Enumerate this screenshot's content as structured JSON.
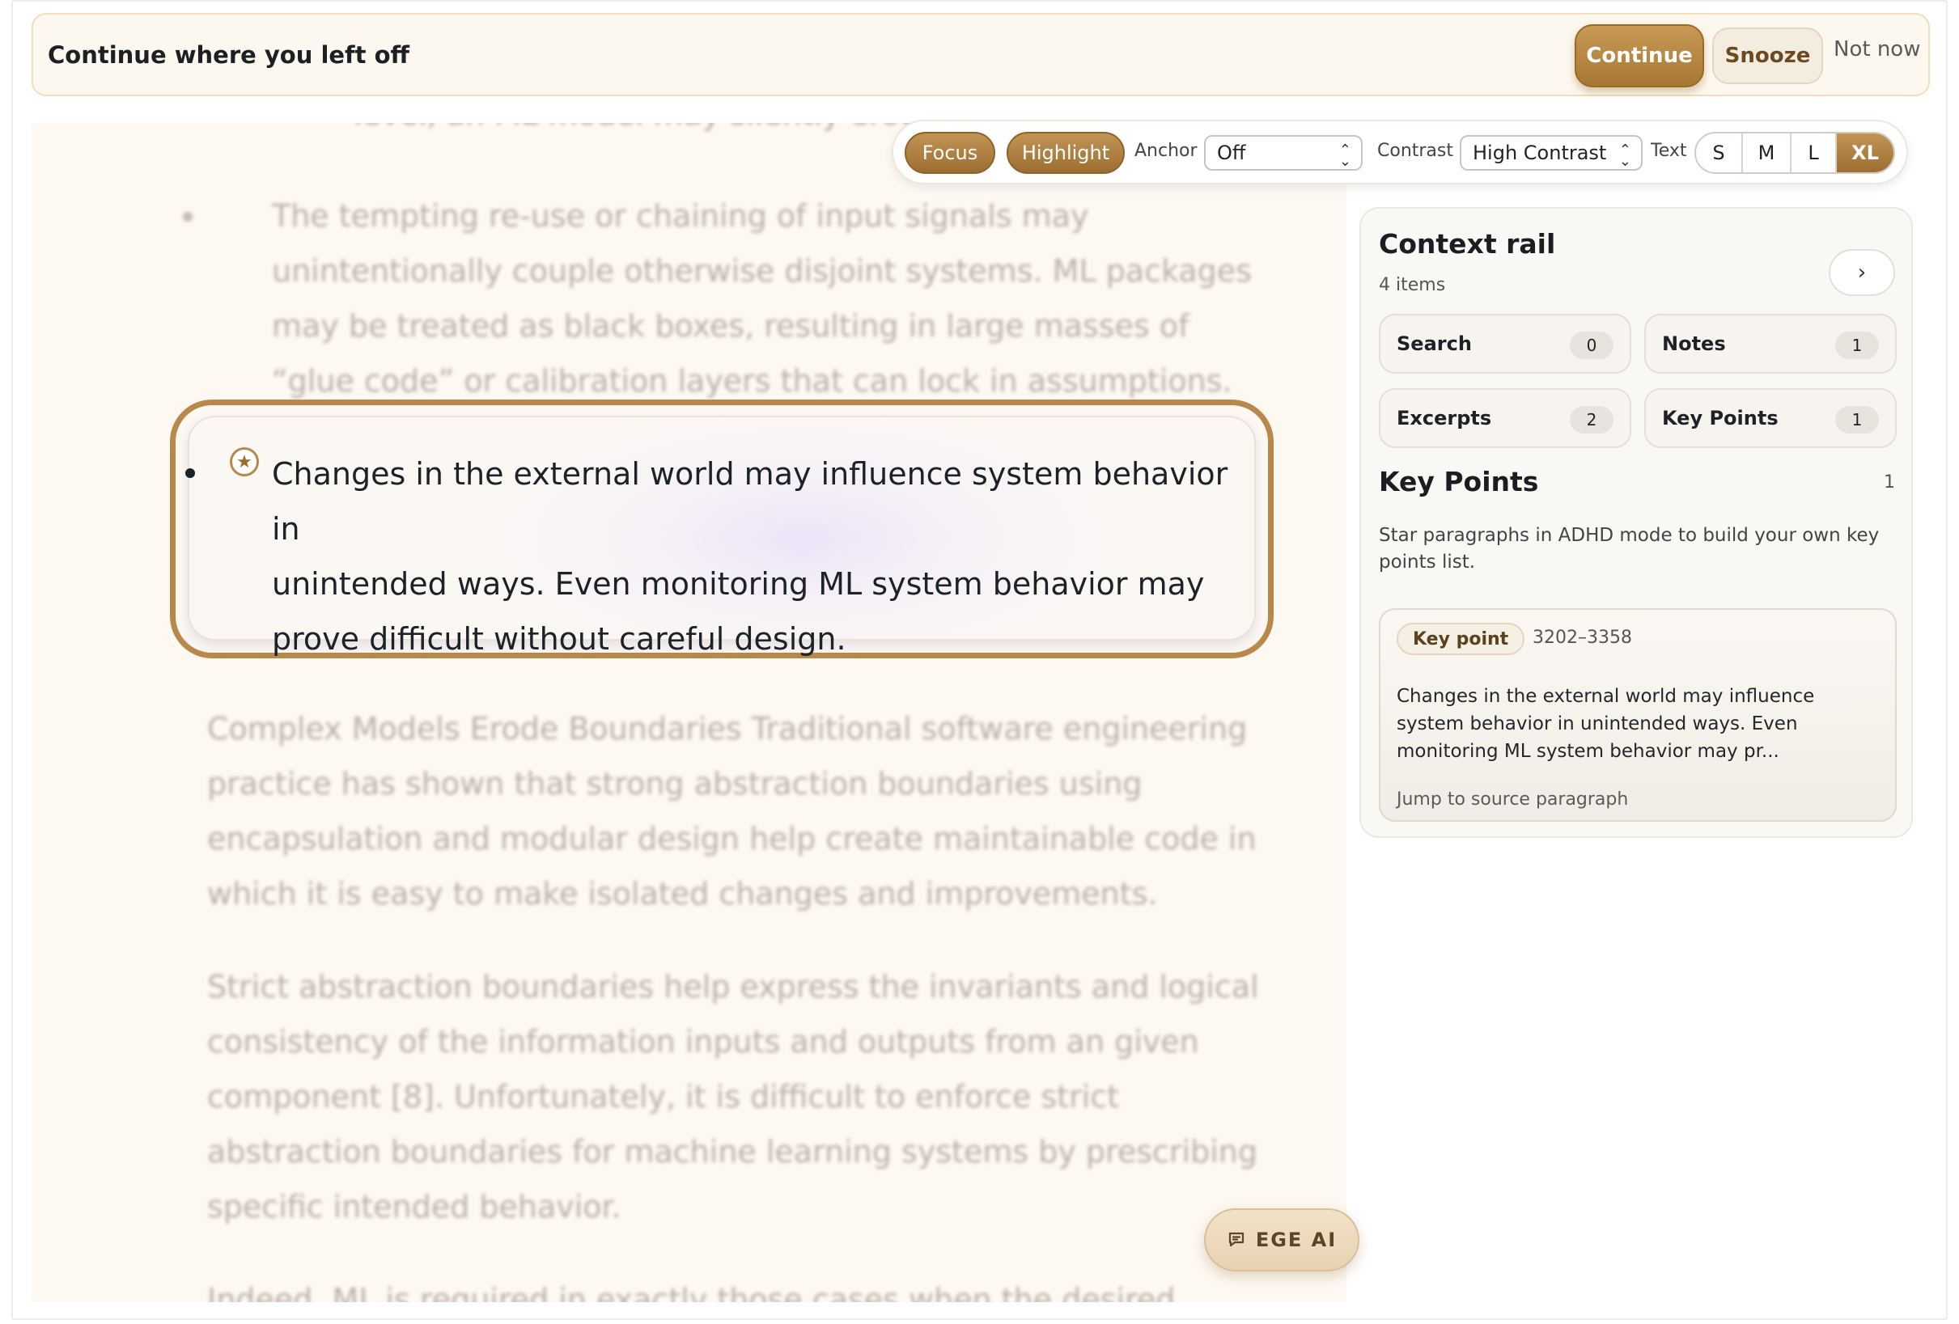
{
  "banner": {
    "title": "Continue where you left off",
    "continue_label": "Continue",
    "snooze_label": "Snooze",
    "not_now_label": "Not now"
  },
  "toolbar": {
    "focus_label": "Focus",
    "highlight_label": "Highlight",
    "anchor_label": "Anchor",
    "anchor_value": "Off",
    "contrast_label": "Contrast",
    "contrast_value": "High Contrast",
    "text_label": "Text",
    "text_sizes": [
      "S",
      "M",
      "L",
      "XL"
    ],
    "text_size_selected": "XL"
  },
  "reader": {
    "top_fragment": "level, an ML model may silently erode abstr",
    "bullet_prev": [
      "The tempting re-use or chaining of input signals may",
      "unintentionally couple otherwise disjoint systems. ML packages",
      "may be treated as black boxes, resulting in large masses of",
      "“glue code” or calibration layers that can lock in assumptions."
    ],
    "focused": [
      "Changes in the external world may influence system behavior in",
      "unintended ways. Even monitoring ML system behavior may",
      "prove difficult without careful design."
    ],
    "para1": [
      "Complex Models Erode Boundaries Traditional software engineering",
      "practice has shown that strong abstraction boundaries using",
      "encapsulation and modular design help create maintainable code in",
      "which it is easy to make isolated changes and improvements."
    ],
    "para2": [
      "Strict abstraction boundaries help express the invariants and logical",
      "consistency of the information inputs and outputs from an given",
      "component [8]. Unfortunately, it is difficult to enforce strict",
      "abstraction boundaries for machine learning systems by prescribing",
      "specific intended behavior."
    ],
    "para3": "Indeed, ML is required in exactly those cases when the desired"
  },
  "rail": {
    "title": "Context rail",
    "count": "4 items",
    "tiles": [
      {
        "label": "Search",
        "count": "0"
      },
      {
        "label": "Notes",
        "count": "1"
      },
      {
        "label": "Excerpts",
        "count": "2"
      },
      {
        "label": "Key Points",
        "count": "1"
      }
    ],
    "key_points": {
      "title": "Key Points",
      "count": "1",
      "hint": "Star paragraphs in ADHD mode to build your own key points list.",
      "card": {
        "badge": "Key point",
        "range": "3202–3358",
        "text": "Changes in the external world may influence system behavior in unintended ways. Even monitoring ML system behavior may pr...",
        "jump": "Jump to source paragraph"
      }
    }
  },
  "ai_button": {
    "label": "EGE AI"
  },
  "colors": {
    "accent": "#b8894a",
    "accent_dark": "#9d6e31",
    "banner_bg": "#fdf8ef",
    "reader_bg": "#fdf8f2"
  }
}
